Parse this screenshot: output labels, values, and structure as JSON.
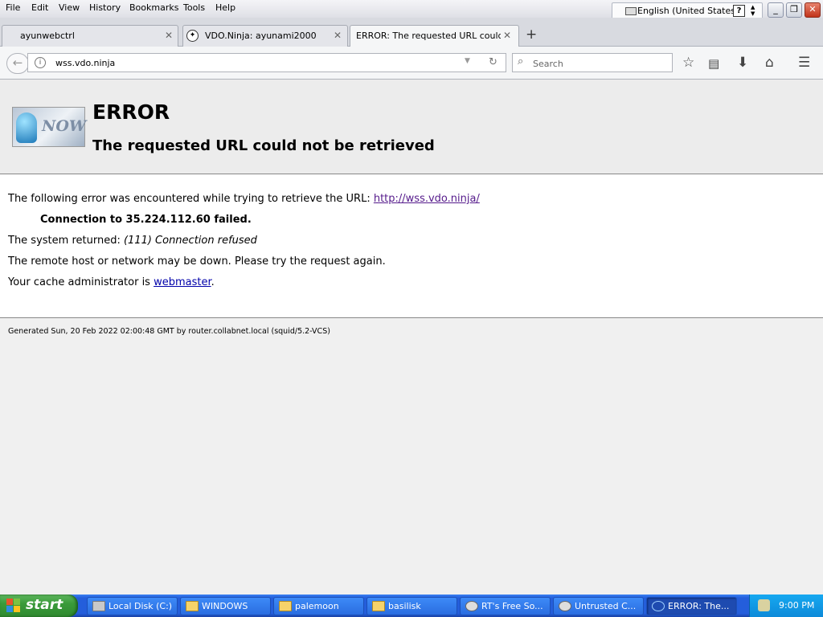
{
  "menu": [
    "File",
    "Edit",
    "View",
    "History",
    "Bookmarks",
    "Tools",
    "Help"
  ],
  "language": {
    "label": "English (United States)",
    "help": "?"
  },
  "tabs": [
    {
      "title": "ayunwebctrl"
    },
    {
      "title": "VDO.Ninja: ayunami2000"
    },
    {
      "title": "ERROR: The requested URL could ..."
    }
  ],
  "nav": {
    "url": "wss.vdo.ninja",
    "search_placeholder": "Search"
  },
  "page": {
    "h1": "ERROR",
    "h2": "The requested URL could not be retrieved",
    "line1_prefix": "The following error was encountered while trying to retrieve the URL: ",
    "line1_link": "http://wss.vdo.ninja/",
    "connection": "Connection to 35.224.112.60 failed.",
    "system_prefix": "The system returned: ",
    "system_error": "(111) Connection refused",
    "remote": "The remote host or network may be down. Please try the request again.",
    "cache_prefix": "Your cache administrator is ",
    "cache_link": "webmaster",
    "cache_suffix": ".",
    "generated": "Generated Sun, 20 Feb 2022 02:00:48 GMT by router.collabnet.local (squid/5.2-VCS)",
    "logo_text": "NOW"
  },
  "taskbar": {
    "start": "start",
    "items": [
      {
        "label": "Local Disk (C:)"
      },
      {
        "label": "WINDOWS"
      },
      {
        "label": "palemoon"
      },
      {
        "label": "basilisk"
      },
      {
        "label": "RT's Free So..."
      },
      {
        "label": "Untrusted C..."
      },
      {
        "label": "ERROR: The..."
      }
    ],
    "clock": "9:00 PM"
  },
  "colors": {
    "link": "#0000aa",
    "visited_link": "#551a8b",
    "taskbar": "#245edb",
    "start": "#3a9a3a"
  }
}
